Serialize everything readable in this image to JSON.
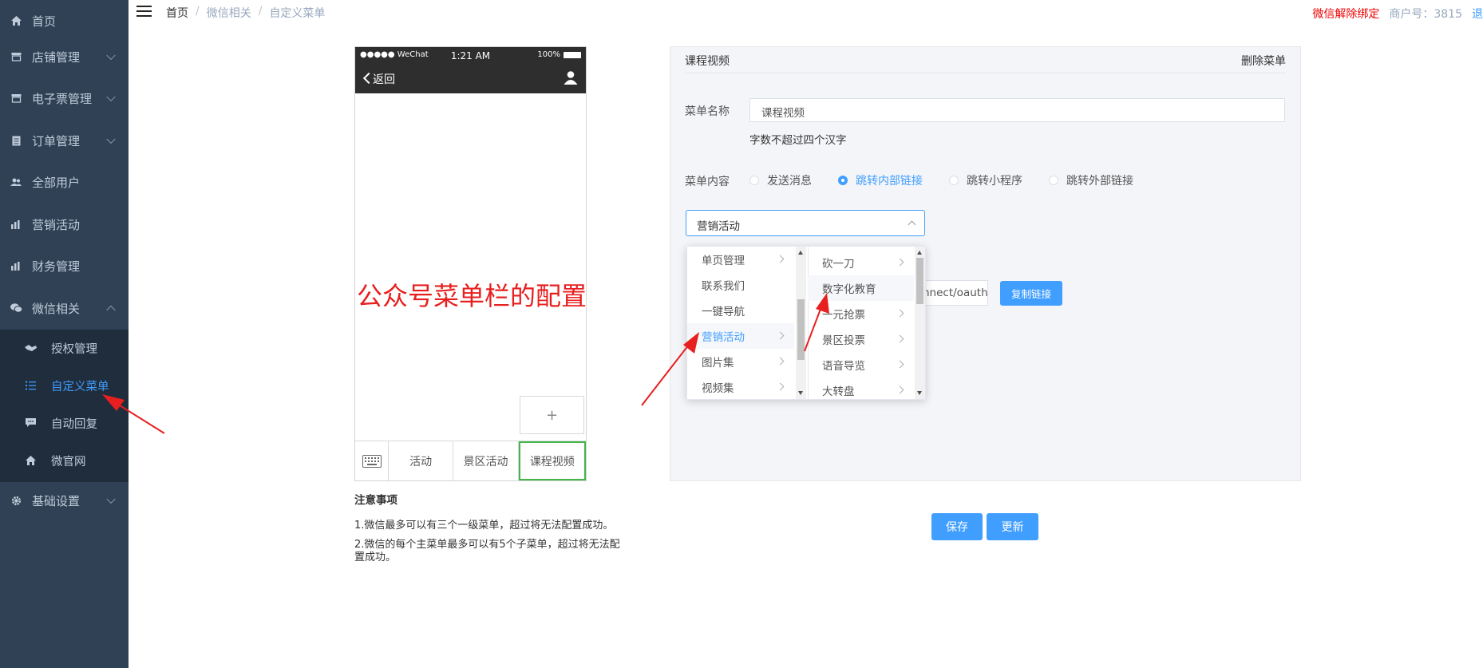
{
  "sidebar": {
    "items": [
      {
        "label": "首页",
        "icon": "home-icon"
      },
      {
        "label": "店铺管理",
        "icon": "store-icon"
      },
      {
        "label": "电子票管理",
        "icon": "ticket-icon"
      },
      {
        "label": "订单管理",
        "icon": "order-icon"
      },
      {
        "label": "全部用户",
        "icon": "users-icon"
      },
      {
        "label": "营销活动",
        "icon": "chart-icon"
      },
      {
        "label": "财务管理",
        "icon": "finance-icon"
      },
      {
        "label": "微信相关",
        "icon": "wechat-icon"
      },
      {
        "label": "基础设置",
        "icon": "gear-icon"
      }
    ],
    "sub_items": [
      {
        "label": "授权管理",
        "icon": "handshake-icon"
      },
      {
        "label": "自定义菜单",
        "icon": "list-icon",
        "active": true
      },
      {
        "label": "自动回复",
        "icon": "message-icon"
      },
      {
        "label": "微官网",
        "icon": "home-icon"
      }
    ]
  },
  "header": {
    "breadcrumb": [
      "首页",
      "微信相关",
      "自定义菜单"
    ],
    "unbind": "微信解除绑定",
    "merchant": "商户号：3815",
    "logout": "退出"
  },
  "phone": {
    "carrier": "●●●●● WeChat",
    "time": "1:21 AM",
    "battery": "100%",
    "back": "返回",
    "overlay_title": "公众号菜单栏的配置",
    "add": "+",
    "menus": [
      "活动",
      "景区活动",
      "课程视频"
    ]
  },
  "notes": {
    "title": "注意事项",
    "line1": "1.微信最多可以有三个一级菜单，超过将无法配置成功。",
    "line2": "2.微信的每个主菜单最多可以有5个子菜单，超过将无法配置成功。"
  },
  "editor": {
    "title": "课程视频",
    "delete": "删除菜单",
    "name_label": "菜单名称",
    "name_value": "课程视频",
    "name_hint": "字数不超过四个汉字",
    "content_label": "菜单内容",
    "options": [
      "发送消息",
      "跳转内部链接",
      "跳转小程序",
      "跳转外部链接"
    ],
    "selected_option": "跳转内部链接",
    "select_value": "营销活动",
    "link_value": "nnect/oauth",
    "copy_button": "复制链接"
  },
  "cascader": {
    "level1": [
      "单页管理",
      "联系我们",
      "一键导航",
      "营销活动",
      "图片集",
      "视频集"
    ],
    "level1_active": "营销活动",
    "level2": [
      "砍一刀",
      "数字化教育",
      "一元抢票",
      "景区投票",
      "语音导览",
      "大转盘"
    ]
  },
  "buttons": {
    "save": "保存",
    "update": "更新"
  },
  "colors": {
    "sidebar": "#304156",
    "submenu": "#1f2d3d",
    "accent": "#409eff",
    "annotation": "#e81f1f",
    "wechat_green": "#44b549"
  }
}
